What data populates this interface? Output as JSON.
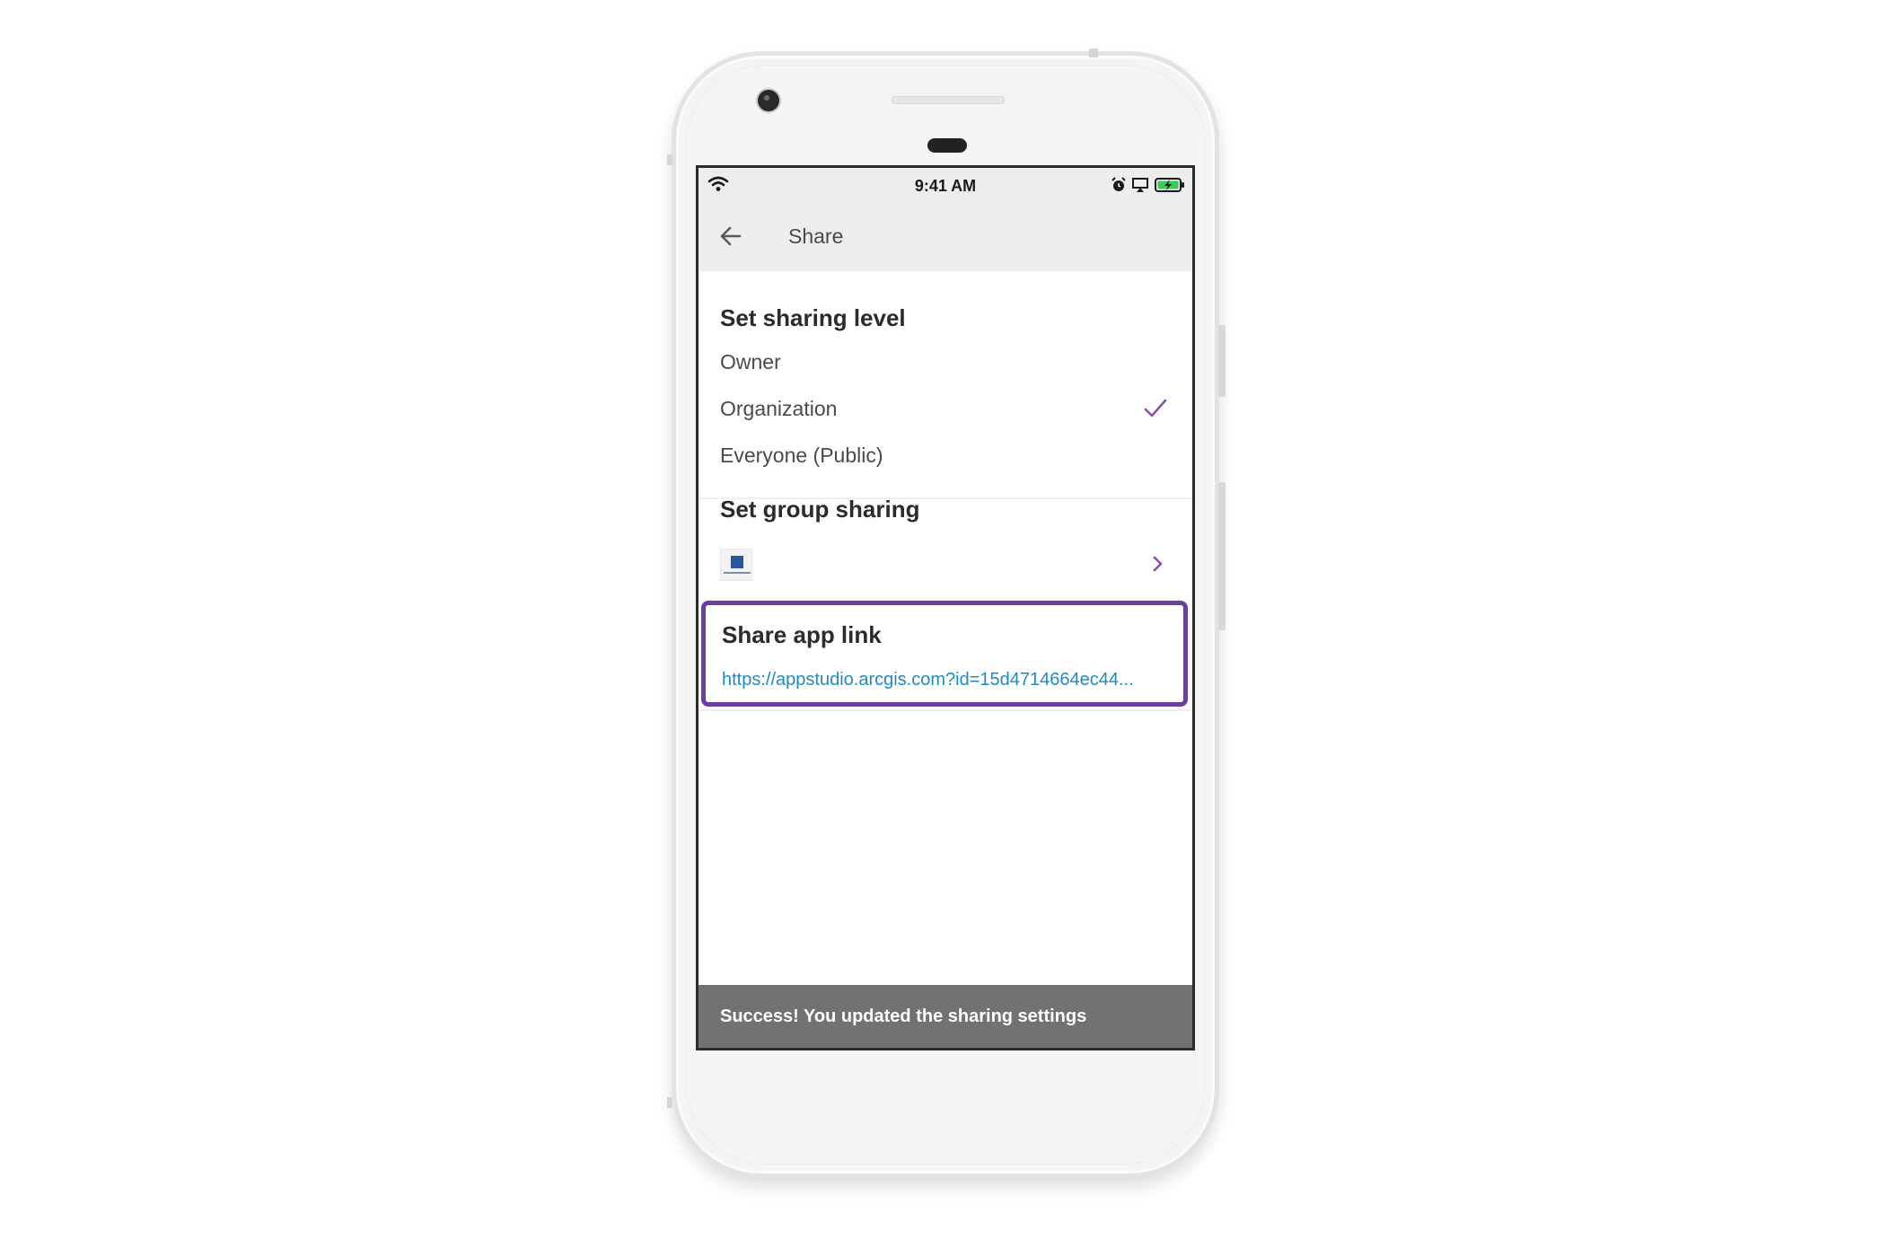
{
  "status_bar": {
    "time": "9:41 AM",
    "icons": [
      "wifi-icon",
      "alarm-icon",
      "airplay-icon",
      "battery-charging-icon"
    ],
    "battery_color": "#3cc85a"
  },
  "app_bar": {
    "title": "Share",
    "back_icon": "arrow-left-icon"
  },
  "sharing_level": {
    "title": "Set sharing level",
    "options": [
      {
        "label": "Owner",
        "selected": false
      },
      {
        "label": "Organization",
        "selected": true
      },
      {
        "label": "Everyone (Public)",
        "selected": false
      }
    ],
    "check_color": "#8a4fb0"
  },
  "group_sharing": {
    "title": "Set group sharing",
    "group_icon": "group-thumbnail",
    "chevron_icon": "chevron-right-icon",
    "chevron_color": "#8a4fb0"
  },
  "app_link": {
    "title": "Share app link",
    "url": "https://appstudio.arcgis.com?id=15d4714664ec44...",
    "link_color": "#1f8bc2",
    "highlight_color": "#6b3fa0"
  },
  "toast": {
    "message": "Success! You updated the sharing settings"
  }
}
